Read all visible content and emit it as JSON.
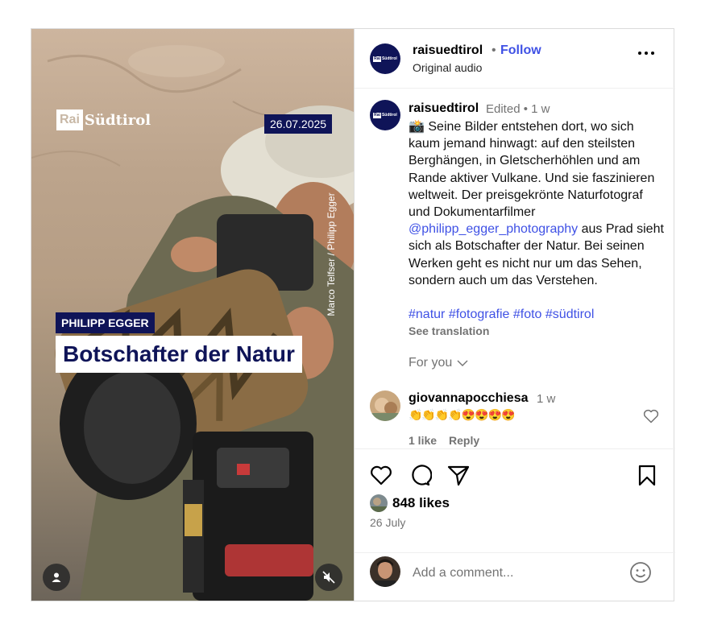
{
  "media": {
    "brand_box": "Rai",
    "brand_name": "Südtirol",
    "date": "26.07.2025",
    "photo_credit": "Marco Telfser / Philipp Egger",
    "name_badge": "PHILIPP EGGER",
    "headline": "Botschafter der Natur",
    "user_tag_icon": "person-icon",
    "mute_icon": "speaker-muted-icon"
  },
  "header": {
    "username": "raisuedtirol",
    "separator": "•",
    "follow_label": "Follow",
    "audio_label": "Original audio",
    "more_icon": "more-horizontal-icon",
    "avatar_box": "Rai",
    "avatar_name": "Südtirol"
  },
  "caption": {
    "username": "raisuedtirol",
    "meta": "Edited • 1 w",
    "text_before_mention": "📸 Seine Bilder entstehen dort, wo sich kaum jemand hinwagt: auf den steilsten Berghängen, in Gletscherhöhlen und am Rande aktiver Vulkane. Und sie faszinieren weltweit. Der preisgekrönte Naturfotograf und Dokumentarfilmer",
    "mention": "@philipp_egger_photography",
    "text_after_mention": " aus Prad sieht sich als Botschafter der Natur. Bei seinen Werken geht es nicht nur um das Sehen, sondern auch um das Verstehen.",
    "hashtags": "#natur #fotografie #foto #südtirol",
    "see_translation": "See translation",
    "for_you": "For you"
  },
  "comment": {
    "username": "giovannapocchiesa",
    "time": "1 w",
    "text": "👏👏👏👏😍😍😍😍",
    "likes": "1 like",
    "reply": "Reply"
  },
  "actions": {
    "like_icon": "heart-icon",
    "comment_icon": "comment-icon",
    "share_icon": "send-icon",
    "save_icon": "bookmark-icon",
    "likes_count": "848 likes",
    "date": "26 July"
  },
  "comment_bar": {
    "placeholder": "Add a comment...",
    "emoji_icon": "smiley-icon"
  },
  "colors": {
    "brand_navy": "#0f1458",
    "link_blue": "#3f51e5",
    "muted_gray": "#737373",
    "border": "#dbdbdb"
  }
}
